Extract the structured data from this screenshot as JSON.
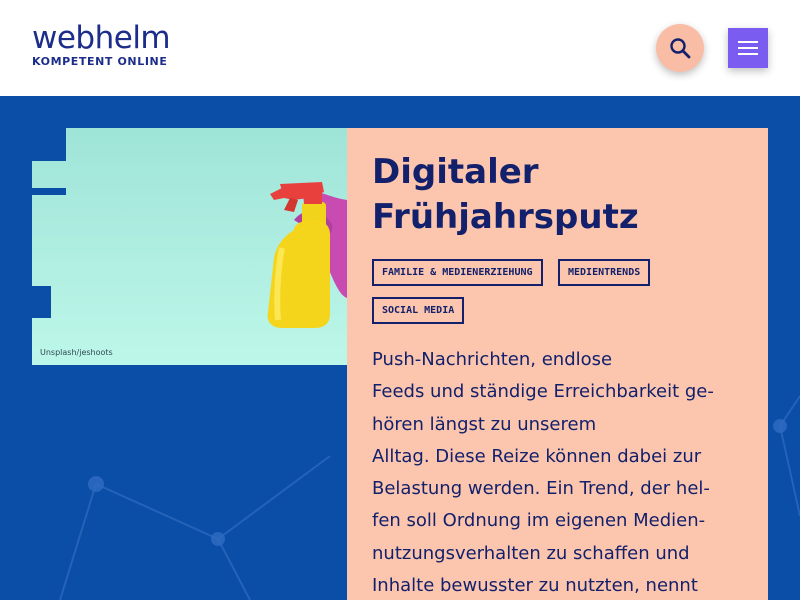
{
  "header": {
    "logo_word": "webhelm",
    "logo_tagline": "KOMPETENT ONLINE",
    "search_icon": "search-icon",
    "menu_icon": "hamburger-menu-icon"
  },
  "colors": {
    "brand_navy": "#1c2d8a",
    "hero_blue": "#0a4ea8",
    "card_peach": "#fcc6ae",
    "search_peach": "#f9bda6",
    "menu_purple": "#7b5cf0",
    "text_navy": "#13206b"
  },
  "article": {
    "image_credit": "Unsplash/jeshoots",
    "title_lines": [
      "Digitaler",
      "Frühjahrsputz"
    ],
    "tags": [
      "FAMILIE & MEDIENERZIEHUNG",
      "MEDIENTRENDS",
      "SOCIAL MEDIA"
    ],
    "teaser_lines": [
      "Push-Nachrichten, endlose",
      "Feeds und ständige Erreichbarkeit ge-",
      "hören längst zu unserem",
      "Alltag. Diese Reize können dabei zur",
      "Belastung werden. Ein Trend, der hel-",
      "fen soll Ordnung im eigenen Medien-",
      "nutzungsverhalten zu schaffen und",
      "Inhalte bewusster zu nutzten, nennt"
    ]
  }
}
